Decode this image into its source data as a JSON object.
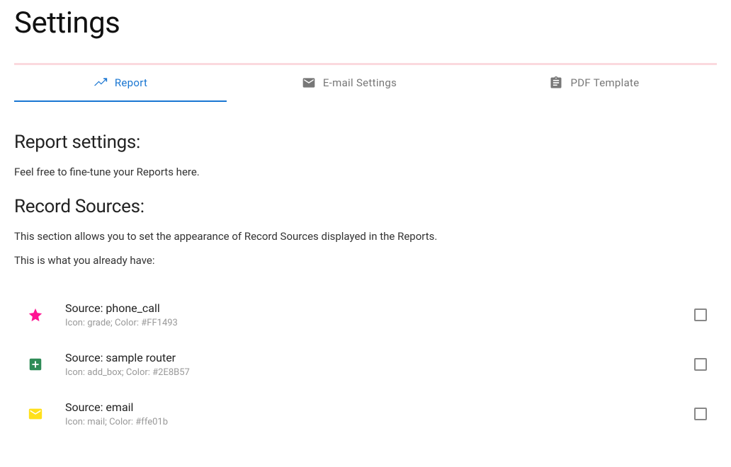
{
  "page": {
    "title": "Settings"
  },
  "tabs": [
    {
      "label": "Report",
      "icon": "chart-line-icon",
      "active": true
    },
    {
      "label": "E-mail Settings",
      "icon": "mail-icon",
      "active": false
    },
    {
      "label": "PDF Template",
      "icon": "assignment-icon",
      "active": false
    }
  ],
  "report": {
    "heading": "Report settings:",
    "intro": "Feel free to fine-tune your Reports here.",
    "sources_heading": "Record Sources:",
    "sources_intro": "This section allows you to set the appearance of Record Sources displayed in the Reports.",
    "sources_already": "This is what you already have:"
  },
  "sources": [
    {
      "primary": "Source: phone_call",
      "secondary": "Icon: grade; Color: #FF1493",
      "icon": "grade",
      "color": "#FF1493",
      "checked": false
    },
    {
      "primary": "Source: sample router",
      "secondary": "Icon: add_box; Color: #2E8B57",
      "icon": "add_box",
      "color": "#2E8B57",
      "checked": false
    },
    {
      "primary": "Source: email",
      "secondary": "Icon: mail; Color: #ffe01b",
      "icon": "mail",
      "color": "#ffe01b",
      "checked": false
    }
  ]
}
